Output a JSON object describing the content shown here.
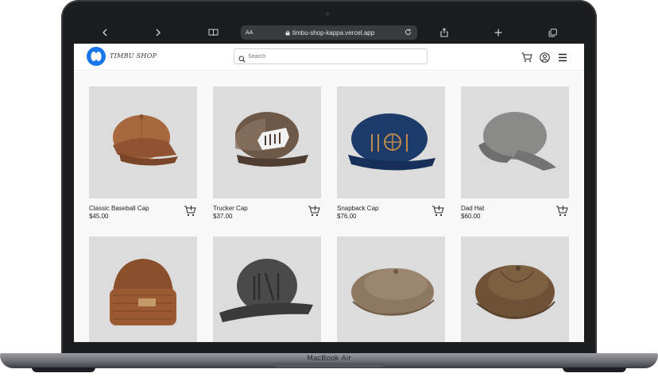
{
  "device": {
    "base_label": "MacBook Air"
  },
  "browser": {
    "url": "timbu-shop-kappa.vercel.app",
    "text_size_label": "AA"
  },
  "site": {
    "logo_text": "TIMBU SHOP",
    "brand_color": "#1976e8",
    "search_placeholder": "Search"
  },
  "products": [
    {
      "name": "Classic Baseball Cap",
      "price": "$45.00",
      "color": "#a8683f"
    },
    {
      "name": "Trucker Cap",
      "price": "$37.00",
      "color": "#6e5848"
    },
    {
      "name": "Snapback Cap",
      "price": "$76.00",
      "color": "#1d3b6a"
    },
    {
      "name": "Dad Hat",
      "price": "$60.00",
      "color": "#8a8a88"
    },
    {
      "name": "",
      "price": "",
      "color": "#8a4f2b"
    },
    {
      "name": "",
      "price": "",
      "color": "#4a4a4a"
    },
    {
      "name": "",
      "price": "",
      "color": "#8e7862"
    },
    {
      "name": "",
      "price": "",
      "color": "#6e5237"
    }
  ]
}
